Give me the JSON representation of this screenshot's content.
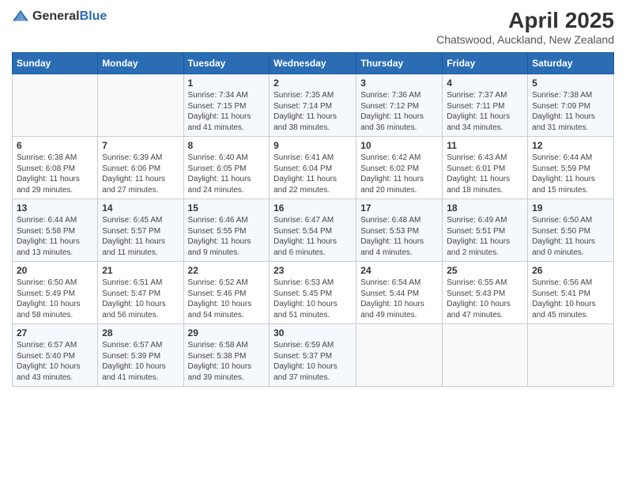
{
  "header": {
    "logo_general": "General",
    "logo_blue": "Blue",
    "title": "April 2025",
    "subtitle": "Chatswood, Auckland, New Zealand"
  },
  "weekdays": [
    "Sunday",
    "Monday",
    "Tuesday",
    "Wednesday",
    "Thursday",
    "Friday",
    "Saturday"
  ],
  "weeks": [
    [
      {
        "day": "",
        "info": ""
      },
      {
        "day": "",
        "info": ""
      },
      {
        "day": "1",
        "info": "Sunrise: 7:34 AM\nSunset: 7:15 PM\nDaylight: 11 hours and 41 minutes."
      },
      {
        "day": "2",
        "info": "Sunrise: 7:35 AM\nSunset: 7:14 PM\nDaylight: 11 hours and 38 minutes."
      },
      {
        "day": "3",
        "info": "Sunrise: 7:36 AM\nSunset: 7:12 PM\nDaylight: 11 hours and 36 minutes."
      },
      {
        "day": "4",
        "info": "Sunrise: 7:37 AM\nSunset: 7:11 PM\nDaylight: 11 hours and 34 minutes."
      },
      {
        "day": "5",
        "info": "Sunrise: 7:38 AM\nSunset: 7:09 PM\nDaylight: 11 hours and 31 minutes."
      }
    ],
    [
      {
        "day": "6",
        "info": "Sunrise: 6:38 AM\nSunset: 6:08 PM\nDaylight: 11 hours and 29 minutes."
      },
      {
        "day": "7",
        "info": "Sunrise: 6:39 AM\nSunset: 6:06 PM\nDaylight: 11 hours and 27 minutes."
      },
      {
        "day": "8",
        "info": "Sunrise: 6:40 AM\nSunset: 6:05 PM\nDaylight: 11 hours and 24 minutes."
      },
      {
        "day": "9",
        "info": "Sunrise: 6:41 AM\nSunset: 6:04 PM\nDaylight: 11 hours and 22 minutes."
      },
      {
        "day": "10",
        "info": "Sunrise: 6:42 AM\nSunset: 6:02 PM\nDaylight: 11 hours and 20 minutes."
      },
      {
        "day": "11",
        "info": "Sunrise: 6:43 AM\nSunset: 6:01 PM\nDaylight: 11 hours and 18 minutes."
      },
      {
        "day": "12",
        "info": "Sunrise: 6:44 AM\nSunset: 5:59 PM\nDaylight: 11 hours and 15 minutes."
      }
    ],
    [
      {
        "day": "13",
        "info": "Sunrise: 6:44 AM\nSunset: 5:58 PM\nDaylight: 11 hours and 13 minutes."
      },
      {
        "day": "14",
        "info": "Sunrise: 6:45 AM\nSunset: 5:57 PM\nDaylight: 11 hours and 11 minutes."
      },
      {
        "day": "15",
        "info": "Sunrise: 6:46 AM\nSunset: 5:55 PM\nDaylight: 11 hours and 9 minutes."
      },
      {
        "day": "16",
        "info": "Sunrise: 6:47 AM\nSunset: 5:54 PM\nDaylight: 11 hours and 6 minutes."
      },
      {
        "day": "17",
        "info": "Sunrise: 6:48 AM\nSunset: 5:53 PM\nDaylight: 11 hours and 4 minutes."
      },
      {
        "day": "18",
        "info": "Sunrise: 6:49 AM\nSunset: 5:51 PM\nDaylight: 11 hours and 2 minutes."
      },
      {
        "day": "19",
        "info": "Sunrise: 6:50 AM\nSunset: 5:50 PM\nDaylight: 11 hours and 0 minutes."
      }
    ],
    [
      {
        "day": "20",
        "info": "Sunrise: 6:50 AM\nSunset: 5:49 PM\nDaylight: 10 hours and 58 minutes."
      },
      {
        "day": "21",
        "info": "Sunrise: 6:51 AM\nSunset: 5:47 PM\nDaylight: 10 hours and 56 minutes."
      },
      {
        "day": "22",
        "info": "Sunrise: 6:52 AM\nSunset: 5:46 PM\nDaylight: 10 hours and 54 minutes."
      },
      {
        "day": "23",
        "info": "Sunrise: 6:53 AM\nSunset: 5:45 PM\nDaylight: 10 hours and 51 minutes."
      },
      {
        "day": "24",
        "info": "Sunrise: 6:54 AM\nSunset: 5:44 PM\nDaylight: 10 hours and 49 minutes."
      },
      {
        "day": "25",
        "info": "Sunrise: 6:55 AM\nSunset: 5:43 PM\nDaylight: 10 hours and 47 minutes."
      },
      {
        "day": "26",
        "info": "Sunrise: 6:56 AM\nSunset: 5:41 PM\nDaylight: 10 hours and 45 minutes."
      }
    ],
    [
      {
        "day": "27",
        "info": "Sunrise: 6:57 AM\nSunset: 5:40 PM\nDaylight: 10 hours and 43 minutes."
      },
      {
        "day": "28",
        "info": "Sunrise: 6:57 AM\nSunset: 5:39 PM\nDaylight: 10 hours and 41 minutes."
      },
      {
        "day": "29",
        "info": "Sunrise: 6:58 AM\nSunset: 5:38 PM\nDaylight: 10 hours and 39 minutes."
      },
      {
        "day": "30",
        "info": "Sunrise: 6:59 AM\nSunset: 5:37 PM\nDaylight: 10 hours and 37 minutes."
      },
      {
        "day": "",
        "info": ""
      },
      {
        "day": "",
        "info": ""
      },
      {
        "day": "",
        "info": ""
      }
    ]
  ]
}
